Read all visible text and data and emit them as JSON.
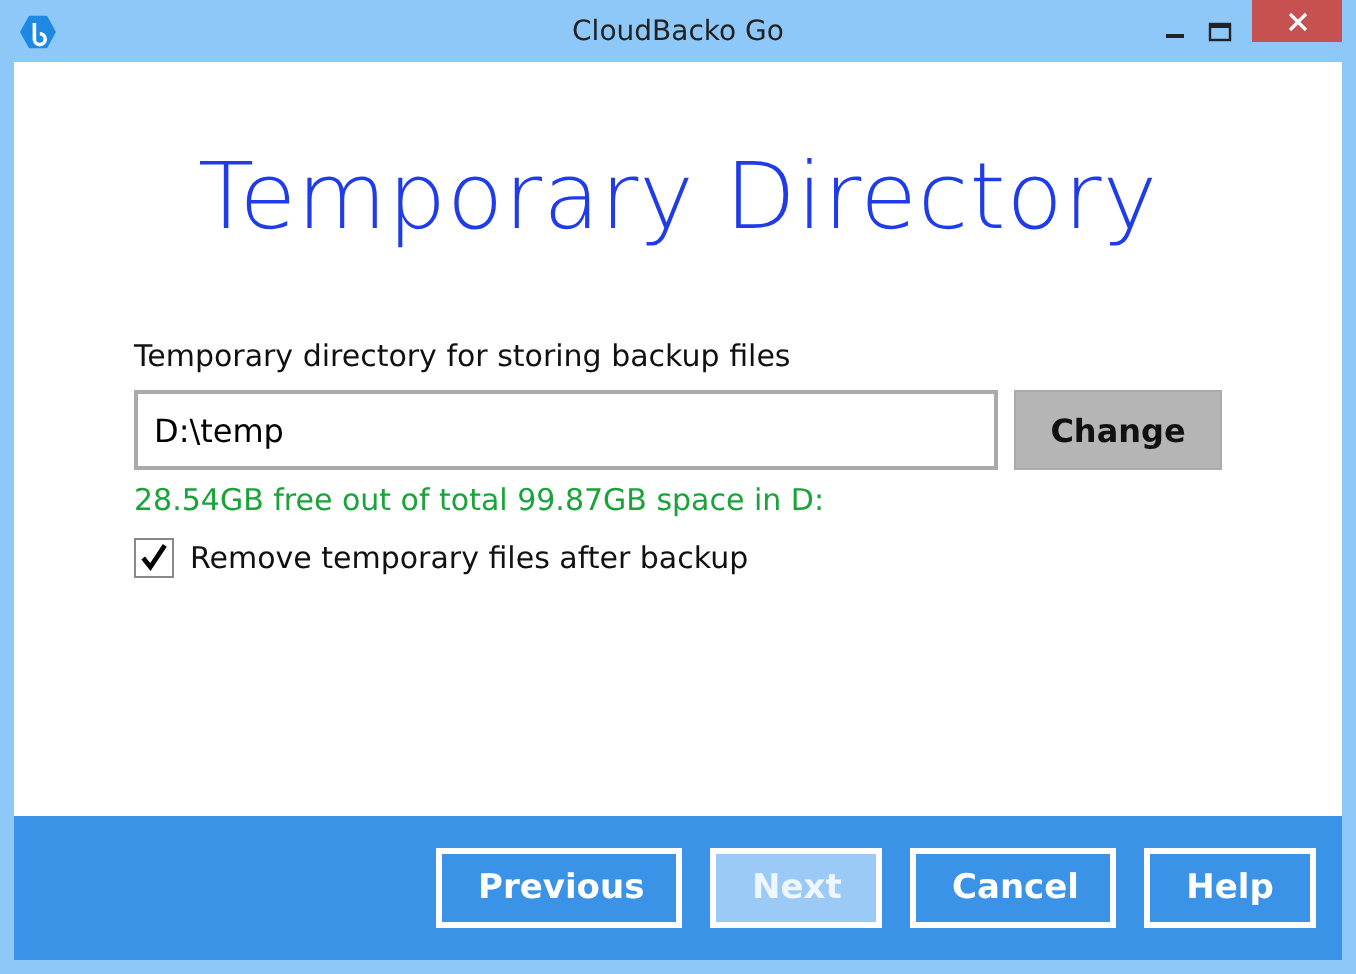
{
  "window": {
    "title": "CloudBacko Go"
  },
  "heading": "Temporary Directory",
  "directory": {
    "label": "Temporary directory for storing backup files",
    "value": "D:\\temp",
    "change_button": "Change",
    "space_info": "28.54GB free out of total 99.87GB space in D:"
  },
  "remove_option": {
    "label": "Remove temporary files after backup",
    "checked": true
  },
  "buttons": [
    {
      "label": "Previous",
      "disabled": false
    },
    {
      "label": "Next",
      "disabled": true
    },
    {
      "label": "Cancel",
      "disabled": false
    },
    {
      "label": "Help",
      "disabled": false
    }
  ]
}
